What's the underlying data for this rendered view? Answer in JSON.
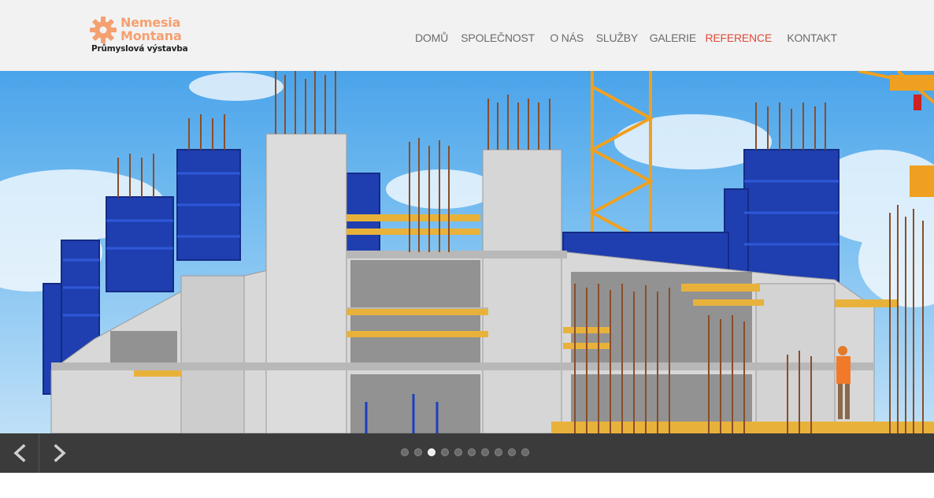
{
  "logo": {
    "line1": "Nemesia",
    "line2": "Montana",
    "tagline": "Průmyslová výstavba",
    "icon": "gear-icon",
    "color": "#f5a070"
  },
  "nav": {
    "items": [
      {
        "label": "DOMŮ",
        "active": false
      },
      {
        "label": "SPOLEČNOST",
        "active": false
      },
      {
        "label": "O NÁS",
        "active": false
      },
      {
        "label": "SLUŽBY",
        "active": false
      },
      {
        "label": "GALERIE",
        "active": false
      },
      {
        "label": "REFERENCE",
        "active": true
      },
      {
        "label": "KONTAKT",
        "active": false
      }
    ],
    "active_color": "#e04a3a"
  },
  "hero": {
    "image": "construction-site-photo"
  },
  "slider": {
    "prev_icon": "chevron-left-icon",
    "next_icon": "chevron-right-icon",
    "slide_count": 10,
    "active_slide": 3
  }
}
